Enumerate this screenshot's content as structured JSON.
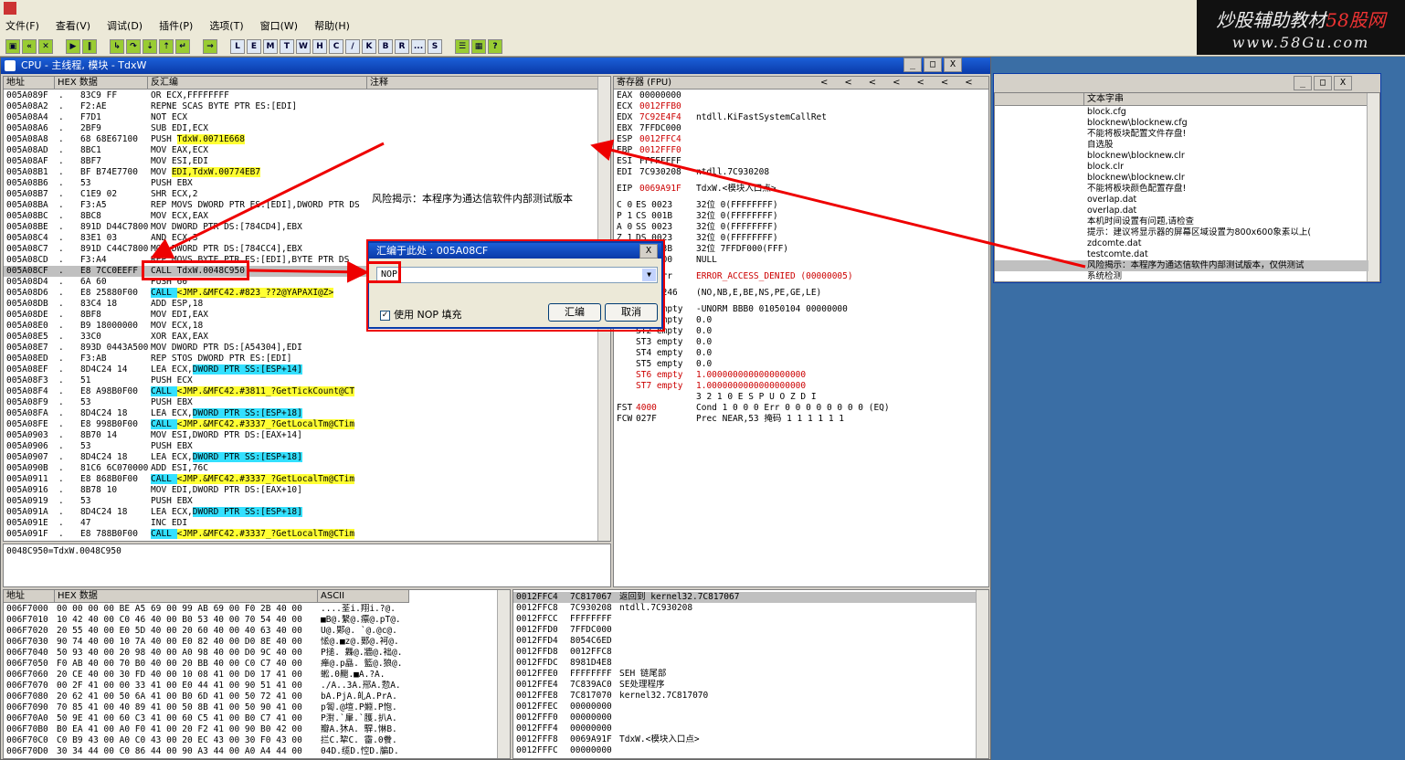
{
  "menu": {
    "items": [
      "文件(F)",
      "查看(V)",
      "调试(D)",
      "插件(P)",
      "选项(T)",
      "窗口(W)",
      "帮助(H)"
    ]
  },
  "toolbar": {
    "letters": [
      "L",
      "E",
      "M",
      "T",
      "W",
      "H",
      "C",
      "/",
      "K",
      "B",
      "R",
      "...",
      "S"
    ]
  },
  "logo": {
    "line1_a": "炒股辅助教材",
    "line1_b": "58股网",
    "line2": "www.58Gu.com"
  },
  "cpu": {
    "title": "CPU - 主线程, 模块 - TdxW",
    "disasm_headers": [
      "地址",
      "HEX 数据",
      "反汇编",
      "注释"
    ],
    "rows": [
      [
        "005A089F",
        "83C9 FF",
        "OR ECX,FFFFFFFF",
        ""
      ],
      [
        "005A08A2",
        "F2:AE",
        "REPNE SCAS BYTE PTR ES:[EDI]",
        ""
      ],
      [
        "005A08A4",
        "F7D1",
        "NOT ECX",
        ""
      ],
      [
        "005A08A6",
        "2BF9",
        "SUB EDI,ECX",
        ""
      ],
      [
        "005A08A8",
        "68 68E67100",
        "PUSH TdxW.0071E668",
        "y"
      ],
      [
        "005A08AD",
        "8BC1",
        "MOV EAX,ECX",
        ""
      ],
      [
        "005A08AF",
        "8BF7",
        "MOV ESI,EDI",
        ""
      ],
      [
        "005A08B1",
        "BF B74E7700",
        "MOV EDI,TdxW.00774EB7",
        "y"
      ],
      [
        "005A08B6",
        "53",
        "PUSH EBX",
        ""
      ],
      [
        "005A08B7",
        "C1E9 02",
        "SHR ECX,2",
        ""
      ],
      [
        "005A08BA",
        "F3:A5",
        "REP MOVS DWORD PTR ES:[EDI],DWORD PTR DS",
        ""
      ],
      [
        "005A08BC",
        "8BC8",
        "MOV ECX,EAX",
        ""
      ],
      [
        "005A08BE",
        "891D D44C7800",
        "MOV DWORD PTR DS:[784CD4],EBX",
        ""
      ],
      [
        "005A08C4",
        "83E1 03",
        "AND ECX,3",
        ""
      ],
      [
        "005A08C7",
        "891D C44C7800",
        "MOV DWORD PTR DS:[784CC4],EBX",
        ""
      ],
      [
        "005A08CD",
        "F3:A4",
        "REP MOVS BYTE PTR ES:[EDI],BYTE PTR DS",
        ""
      ],
      [
        "005A08CF",
        "E8 7CC0EEFF",
        "CALL TdxW.0048C950",
        "sel"
      ],
      [
        "005A08D4",
        "6A 60",
        "PUSH 60",
        ""
      ],
      [
        "005A08D6",
        "E8 25880F00",
        "CALL <JMP.&MFC42.#823_??2@YAPAXI@Z>",
        "c"
      ],
      [
        "005A08DB",
        "83C4 18",
        "ADD ESP,18",
        ""
      ],
      [
        "005A08DE",
        "8BF8",
        "MOV EDI,EAX",
        ""
      ],
      [
        "005A08E0",
        "B9 18000000",
        "MOV ECX,18",
        ""
      ],
      [
        "005A08E5",
        "33C0",
        "XOR EAX,EAX",
        ""
      ],
      [
        "005A08E7",
        "893D 0443A500",
        "MOV DWORD PTR DS:[A54304],EDI",
        ""
      ],
      [
        "005A08ED",
        "F3:AB",
        "REP STOS DWORD PTR ES:[EDI]",
        ""
      ],
      [
        "005A08EF",
        "8D4C24 14",
        "LEA ECX,DWORD PTR SS:[ESP+14]",
        "c2"
      ],
      [
        "005A08F3",
        "51",
        "PUSH ECX",
        ""
      ],
      [
        "005A08F4",
        "E8 A98B0F00",
        "CALL <JMP.&MFC42.#3811_?GetTickCount@CT",
        "c"
      ],
      [
        "005A08F9",
        "53",
        "PUSH EBX",
        ""
      ],
      [
        "005A08FA",
        "8D4C24 18",
        "LEA ECX,DWORD PTR SS:[ESP+18]",
        "c2"
      ],
      [
        "005A08FE",
        "E8 998B0F00",
        "CALL <JMP.&MFC42.#3337_?GetLocalTm@CTim",
        "c"
      ],
      [
        "005A0903",
        "8B70 14",
        "MOV ESI,DWORD PTR DS:[EAX+14]",
        ""
      ],
      [
        "005A0906",
        "53",
        "PUSH EBX",
        ""
      ],
      [
        "005A0907",
        "8D4C24 18",
        "LEA ECX,DWORD PTR SS:[ESP+18]",
        "c2"
      ],
      [
        "005A090B",
        "81C6 6C070000",
        "ADD ESI,76C",
        ""
      ],
      [
        "005A0911",
        "E8 868B0F00",
        "CALL <JMP.&MFC42.#3337_?GetLocalTm@CTim",
        "c"
      ],
      [
        "005A0916",
        "8B78 10",
        "MOV EDI,DWORD PTR DS:[EAX+10]",
        ""
      ],
      [
        "005A0919",
        "53",
        "PUSH EBX",
        ""
      ],
      [
        "005A091A",
        "8D4C24 18",
        "LEA ECX,DWORD PTR SS:[ESP+18]",
        "c2"
      ],
      [
        "005A091E",
        "47",
        "INC EDI",
        ""
      ],
      [
        "005A091F",
        "E8 788B0F00",
        "CALL <JMP.&MFC42.#3337_?GetLocalTm@CTim",
        "c"
      ]
    ],
    "risk_note": "风险揭示：本程序为通达信软件内部测试版本",
    "info_line": "0048C950=TdxW.0048C950",
    "reg_header": "寄存器 (FPU)",
    "regs": [
      [
        "EAX",
        "00000000",
        ""
      ],
      [
        "ECX",
        "0012FFB0",
        ""
      ],
      [
        "EDX",
        "7C92E4F4",
        "ntdll.KiFastSystemCallRet"
      ],
      [
        "EBX",
        "7FFDC000",
        ""
      ],
      [
        "ESP",
        "0012FFC4",
        ""
      ],
      [
        "EBP",
        "0012FFF0",
        ""
      ],
      [
        "ESI",
        "FFFFFFFF",
        ""
      ],
      [
        "EDI",
        "7C930208",
        "ntdll.7C930208"
      ],
      [
        "EIP",
        "0069A91F",
        "TdxW.<模块入口点>"
      ],
      [
        "C 0",
        "ES 0023",
        "32位 0(FFFFFFFF)"
      ],
      [
        "P 1",
        "CS 001B",
        "32位 0(FFFFFFFF)"
      ],
      [
        "A 0",
        "SS 0023",
        "32位 0(FFFFFFFF)"
      ],
      [
        "Z 1",
        "DS 0023",
        "32位 0(FFFFFFFF)"
      ],
      [
        "S 0",
        "FS 003B",
        "32位 7FFDF000(FFF)"
      ],
      [
        "T 0",
        "GS 0000",
        "NULL"
      ],
      [
        "",
        "LastErr",
        "ERROR_ACCESS_DENIED (00000005)"
      ],
      [
        "EFL",
        "00000246",
        "(NO,NB,E,BE,NS,PE,GE,LE)"
      ],
      [
        "",
        "ST0 empty",
        "-UNORM BBB0 01050104 00000000"
      ],
      [
        "",
        "ST1 empty",
        "0.0"
      ],
      [
        "",
        "ST2 empty",
        "0.0"
      ],
      [
        "",
        "ST3 empty",
        "0.0"
      ],
      [
        "",
        "ST4 empty",
        "0.0"
      ],
      [
        "",
        "ST5 empty",
        "0.0"
      ],
      [
        "",
        "ST6 empty",
        "1.0000000000000000000"
      ],
      [
        "",
        "ST7 empty",
        "1.0000000000000000000"
      ],
      [
        "",
        "",
        "3 2 1 0      E S P U O Z D I"
      ],
      [
        "FST",
        "4000",
        "Cond 1 0 0 0  Err 0 0 0 0 0 0 0 0  (EQ)"
      ],
      [
        "FCW",
        "027F",
        "Prec NEAR,53  掩码    1 1 1 1 1 1"
      ]
    ],
    "dump_headers": [
      "地址",
      "HEX 数据",
      "ASCII"
    ],
    "dump_rows": [
      [
        "006F7000",
        "00 00 00 00 BE A5 69 00 99 AB 69 00 F0 2B 40 00",
        "....荃i.翔i.?@."
      ],
      [
        "006F7010",
        "10 42 40 00 C0 46 40 00 B0 53 40 00 70 54 40 00",
        "■B@.繫@.癝@.pT@."
      ],
      [
        "006F7020",
        "20 55 40 00 E0 5D 40 00 20 60 40 00 40 63 40 00",
        " U@.郹@. `@.@c@."
      ],
      [
        "006F7030",
        "90 74 40 00 10 7A 40 00 E0 82 40 00 D0 8E 40 00",
        "恡@.■z@.鄚@.袔@."
      ],
      [
        "006F7040",
        "50 93 40 00 20 98 40 00 A0 98 40 00 D0 9C 40 00",
        "P搥. 橆@.牆@.袦@."
      ],
      [
        "006F7050",
        "F0 AB 40 00 70 B0 40 00 20 BB 40 00 C0 C7 40 00",
        "瘅@.p皛. 籃@.狼@."
      ],
      [
        "006F7060",
        "20 CE 40 00 30 FD 40 00 10 08 41 00 D0 17 41 00",
        " 蜙.0齆.■A.?A."
      ],
      [
        "006F7070",
        "00 2F 41 00 00 33 41 00 E0 44 41 00 90 51 41 00",
        "./A..3A.郉A.愂A."
      ],
      [
        "006F7080",
        "20 62 41 00 50 6A 41 00 B0 6D 41 00 50 72 41 00",
        " bA.PjA.癿A.PrA."
      ],
      [
        "006F7090",
        "70 85 41 00 40 89 41 00 50 8B 41 00 50 90 41 00",
        "p匒.@塇.P婣.P怉."
      ],
      [
        "006F70A0",
        "50 9E 41 00 60 C3 41 00 60 C5 41 00 B0 C7 41 00",
        "P濧.`肁.`臒.扒A."
      ],
      [
        "006F70B0",
        "B0 EA 41 00 A0 F0 41 00 20 F2 41 00 90 B0 42 00",
        "瓣A.狇A. 駻.惏B."
      ],
      [
        "006F70C0",
        "C0 B9 43 00 A0 C0 43 00 20 EC 43 00 30 F0 43 00",
        "拦C.犂C. 霤.0餋."
      ],
      [
        "006F70D0",
        "30 34 44 00 C0 86 44 00 90 A3 44 00 A0 A4 44 00",
        "04D.缆D.悾D.牑D."
      ]
    ],
    "stack_rows": [
      [
        "0012FFC4",
        "7C817067",
        "返回到 kernel32.7C817067",
        "sel"
      ],
      [
        "0012FFC8",
        "7C930208",
        "ntdll.7C930208",
        ""
      ],
      [
        "0012FFCC",
        "FFFFFFFF",
        "",
        ""
      ],
      [
        "0012FFD0",
        "7FFDC000",
        "",
        ""
      ],
      [
        "0012FFD4",
        "8054C6ED",
        "",
        ""
      ],
      [
        "0012FFD8",
        "0012FFC8",
        "",
        ""
      ],
      [
        "0012FFDC",
        "8981D4E8",
        "",
        ""
      ],
      [
        "0012FFE0",
        "FFFFFFFF",
        "SEH 链尾部",
        ""
      ],
      [
        "0012FFE4",
        "7C839AC0",
        "SE处理程序",
        ""
      ],
      [
        "0012FFE8",
        "7C817070",
        "kernel32.7C817070",
        ""
      ],
      [
        "0012FFEC",
        "00000000",
        "",
        ""
      ],
      [
        "0012FFF0",
        "00000000",
        "",
        ""
      ],
      [
        "0012FFF4",
        "00000000",
        "",
        ""
      ],
      [
        "0012FFF8",
        "0069A91F",
        "TdxW.<模块入口点>",
        ""
      ],
      [
        "0012FFFC",
        "00000000",
        "",
        ""
      ]
    ]
  },
  "dialog": {
    "title": "汇编于此处 : 005A08CF",
    "input_value": "NOP",
    "checkbox_label": "使用 NOP 填充",
    "assemble_label": "汇编",
    "cancel_label": "取消"
  },
  "strings": {
    "header": "文本字串",
    "items": [
      "block.cfg",
      "blocknew\\blocknew.cfg",
      "不能将板块配置文件存盘!",
      "自选股",
      "blocknew\\blocknew.clr",
      "block.clr",
      "blocknew\\blocknew.clr",
      "不能将板块颜色配置存盘!",
      "overlap.dat",
      "overlap.dat",
      "本机时间设置有问题,请检查",
      "提示：建议将显示器的屏幕区域设置为800x600象素以上(",
      "zdcomte.dat",
      "testcomte.dat",
      "风险揭示：本程序为通达信软件内部测试版本，仅供测试",
      "系统检测"
    ]
  },
  "window_controls": {
    "min": "_",
    "max": "□",
    "close": "X"
  },
  "reg_nav": [
    "<",
    "<",
    "<",
    "<",
    "<",
    "<",
    "<"
  ]
}
